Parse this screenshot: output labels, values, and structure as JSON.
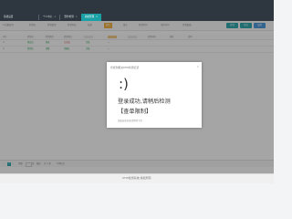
{
  "tabs": [
    {
      "label": "基础设置"
    },
    {
      "label": "个人中心"
    },
    {
      "label": "野外检测"
    },
    {
      "label": "系统管理"
    }
  ],
  "toolbar": {
    "items": [
      "A 批量操作",
      "检测员",
      "检测类型",
      "检测状态",
      "结果",
      "预约",
      "备注",
      "检测时间",
      "采样时间",
      "查看截图"
    ],
    "buttons": [
      "查询",
      "导出",
      "设置"
    ]
  },
  "grid": {
    "columns": [
      "序号",
      "检测员",
      "检测类型",
      "检测项目",
      "检测状态",
      "结果",
      "预约",
      "检测时间",
      "采样",
      "说明"
    ],
    "rows": [
      {
        "c1": "测试员",
        "c2": "登录",
        "c3": "已完成",
        "c4": "合格",
        "c5": "—"
      },
      {
        "c1": "检测员",
        "c2": "查看",
        "c3": "待确认",
        "c4": "合格",
        "c5": "—"
      }
    ],
    "status_colors": {
      "ok": "#1a9b47",
      "warn": "#d23b3b",
      "accent": "#1aa0a5"
    }
  },
  "dialog": {
    "title": "查找到相关KTW检测记录",
    "close": "×",
    "face": ":)",
    "message": "登录成功,请稍后检测",
    "tag": "【查单限制】",
    "footer": "页面自动关闭,请等待下次"
  },
  "pager": {
    "prev": "‹",
    "current": "1",
    "next": "›",
    "to_page": "到第",
    "page_unit": "页",
    "go": "确定",
    "total": "共 1 条",
    "page_size": "10条/页"
  },
  "status": {
    "text": "KTW检测系统 版权所有"
  }
}
